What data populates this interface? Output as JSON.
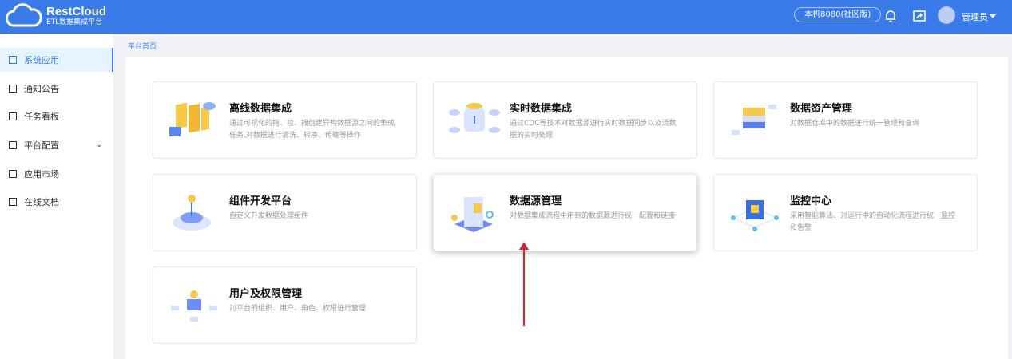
{
  "header": {
    "brand": "RestCloud",
    "brand_sub": "ETL数据集成平台",
    "env": "本机8080(社区版)",
    "user": "管理员"
  },
  "sidebar": {
    "items": [
      {
        "label": "系统应用",
        "icon": "grid-icon",
        "active": true
      },
      {
        "label": "通知公告",
        "icon": "megaphone-icon"
      },
      {
        "label": "任务看板",
        "icon": "board-icon"
      },
      {
        "label": "平台配置",
        "icon": "terminal-icon",
        "expandable": true
      },
      {
        "label": "应用市场",
        "icon": "grid-icon"
      },
      {
        "label": "在线文档",
        "icon": "document-icon"
      }
    ]
  },
  "breadcrumb": "平台首页",
  "cards": [
    {
      "title": "离线数据集成",
      "desc": "通过可视化的拖、拉、拽创建异构数据源之间的集成任务,对数据进行清洗、转换、传输等操作"
    },
    {
      "title": "实时数据集成",
      "desc": "通过CDC等技术对数据源进行实时数据同步以及流数据的实时处理"
    },
    {
      "title": "数据资产管理",
      "desc": "对数据仓库中的数据进行统一管理和查询"
    },
    {
      "title": "组件开发平台",
      "desc": "自定义开发数据处理组件"
    },
    {
      "title": "数据源管理",
      "desc": "对数据集成流程中用到的数据源进行统一配置和链接"
    },
    {
      "title": "监控中心",
      "desc": "采用智能算法、对运行中的自动化流程进行统一监控和告警"
    },
    {
      "title": "用户及权限管理",
      "desc": "对平台的组织、用户、角色、权限进行管理"
    }
  ],
  "colors": {
    "primary": "#3a7bea",
    "annotation": "#e0202a"
  }
}
